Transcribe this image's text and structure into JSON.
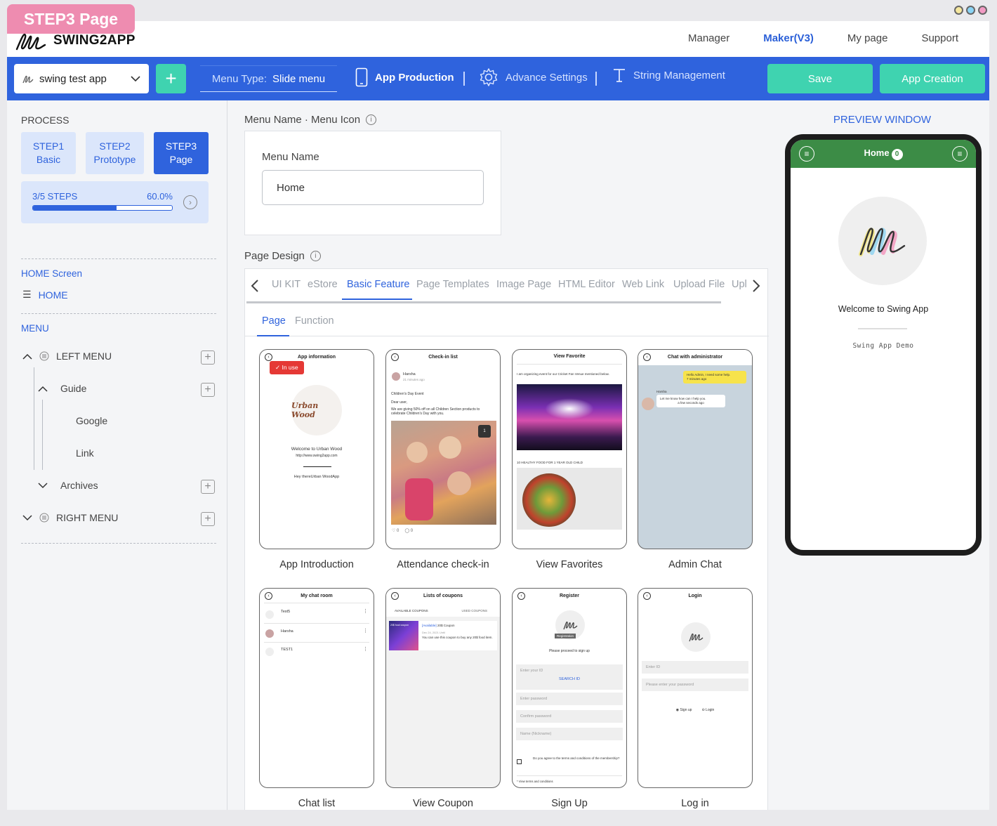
{
  "badge": "STEP3 Page",
  "brand": "SWING2APP",
  "top_menu": [
    {
      "label": "Manager",
      "active": false
    },
    {
      "label": "Maker(V3)",
      "active": true
    },
    {
      "label": "My page",
      "active": false
    },
    {
      "label": "Support",
      "active": false
    }
  ],
  "toolbar": {
    "app_name": "swing test app",
    "add_symbol": "+",
    "menu_type_label": "Menu Type:",
    "menu_type_value": "Slide menu",
    "app_production": "App Production",
    "advance_settings": "Advance Settings",
    "string_management": "String Management",
    "save": "Save",
    "app_creation": "App Creation"
  },
  "sidebar": {
    "process_title": "PROCESS",
    "steps": [
      {
        "line1": "STEP1",
        "line2": "Basic",
        "active": false
      },
      {
        "line1": "STEP2",
        "line2": "Prototype",
        "active": false
      },
      {
        "line1": "STEP3",
        "line2": "Page",
        "active": true
      }
    ],
    "progress_label": "3/5 STEPS",
    "progress_percent_text": "60.0%",
    "progress_fraction": 0.6,
    "home_screen_title": "HOME Screen",
    "home_item": "HOME",
    "menu_title": "MENU",
    "left_menu": "LEFT MENU",
    "guide": "Guide",
    "google": "Google",
    "link": "Link",
    "archives": "Archives",
    "right_menu": "RIGHT MENU"
  },
  "center": {
    "menu_section_title": "Menu Name · Menu Icon",
    "menu_name_label": "Menu Name",
    "menu_name_value": "Home",
    "page_design_title": "Page Design",
    "tabs": [
      "UI KIT",
      "eStore",
      "Basic Feature",
      "Page Templates",
      "Image Page",
      "HTML Editor",
      "Web Link",
      "Upload File",
      "Upl"
    ],
    "active_tab": "Basic Feature",
    "subtabs": [
      "Page",
      "Function"
    ],
    "templates": [
      {
        "name": "App Introduction",
        "title": "App information"
      },
      {
        "name": "Attendance check-in",
        "title": "Check-in list"
      },
      {
        "name": "View Favorites",
        "title": "View Favorite"
      },
      {
        "name": "Admin Chat",
        "title": "Chat with administrator"
      },
      {
        "name": "Chat list",
        "title": "My chat room"
      },
      {
        "name": "View Coupon",
        "title": "Lists of coupons"
      },
      {
        "name": "Sign Up",
        "title": "Register"
      },
      {
        "name": "Log in",
        "title": "Login"
      }
    ],
    "inuse_label": "In use",
    "t1": {
      "welcome": "Welcome to Urban Wood",
      "url": "http://www.swing2app.com",
      "hey": "Hey thereUrban WoodApp",
      "logo": "Urban Wood"
    },
    "t2": {
      "user": "Harsha",
      "time": "21 minutes ago",
      "event": "Children's Day Event",
      "dear": "Dear user,",
      "body": "We are giving 50% off on all Children Section products to celebrate Children's Day with you.",
      "count": "1",
      "likes": "0",
      "comments": "0"
    },
    "t3": {
      "cap1": "I am organizing event for our Cricket Fan Venue mentioned below.",
      "cap2": "10 HEALTHY FOOD FOR 1 YEAR OLD CHILD"
    },
    "t4": {
      "msg1": "Hello Admin, I need some help.",
      "msg1_time": "7 minutes ago",
      "admin": "Harsha",
      "msg2": "Let me know how can I help you.",
      "msg2_time": "a few seconds ago"
    },
    "t5": {
      "rows": [
        "Test5",
        "Harsha",
        "TEST1"
      ]
    },
    "t6": {
      "tab1": "AVAILABLE COUPONS",
      "tab2": "USED COUPONS",
      "status": "[Available]",
      "name": "20$ Coupon",
      "date": "Dec 24, 2021 Until",
      "desc": "You can use this coupon to buy any 20$ food item.",
      "img_text": "20$ food coupon"
    },
    "t7": {
      "reg": "Registration",
      "prompt": "Please proceed to sign up",
      "id": "Enter your ID",
      "search": "SEARCH ID",
      "pw": "Enter password",
      "confirm": "Confirm password",
      "nick": "Name (Nickname)",
      "agree": "Do you agree to the terms and conditions of the membership?",
      "view": "* View terms and conditions"
    },
    "t8": {
      "id": "Enter ID",
      "pw": "Please enter your password",
      "signup": "Sign up",
      "login": "Login"
    }
  },
  "preview": {
    "title": "PREVIEW WINDOW",
    "header_title": "Home",
    "header_badge": "0",
    "welcome": "Welcome to Swing App",
    "demo": "Swing App Demo"
  },
  "colors": {
    "brand_blue": "#2f63dd",
    "teal": "#3fd3b0",
    "pink": "#ee8cb0",
    "preview_green": "#3c8c46",
    "inuse_red": "#e53935"
  }
}
